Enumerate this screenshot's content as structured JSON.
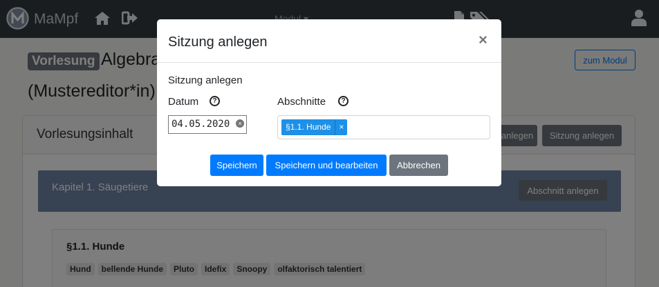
{
  "navbar": {
    "brand": "MaMpf",
    "modul_dropdown": "Modul ▾"
  },
  "page": {
    "badge": "Vorlesung",
    "title": "Algebra",
    "editor": "(Mustereditor*in)",
    "zum_modul_button": "zum Modul",
    "card_header_title": "Vorlesungsinhalt",
    "kapitel_anlegen_button": "anlegen",
    "sitzung_anlegen_button": "Sitzung anlegen",
    "chapter_title": "Kapitel 1. Säugetiere",
    "abschnitt_anlegen_button": "Abschnitt anlegen",
    "section_title": "§1.1. Hunde",
    "tags": [
      "Hund",
      "bellende Hunde",
      "Pluto",
      "Idefix",
      "Snoopy",
      "olfaktorisch talentiert"
    ]
  },
  "modal": {
    "title": "Sitzung anlegen",
    "close": "×",
    "form_heading": "Sitzung anlegen",
    "datum_label": "Datum",
    "datum_value": "04.05.2020",
    "abschnitte_label": "Abschnitte",
    "help_glyph": "?",
    "selected_section": "§1.1. Hunde",
    "chip_remove": "×",
    "clear_glyph": "×",
    "save_button": "Speichern",
    "save_edit_button": "Speichern und bearbeiten",
    "cancel_button": "Abbrechen"
  },
  "colors": {
    "navbar_bg": "#343a40",
    "primary": "#007bff",
    "secondary": "#6c757d",
    "chapter_bg": "#6f85a6",
    "chip_bg": "#1e90e8"
  }
}
